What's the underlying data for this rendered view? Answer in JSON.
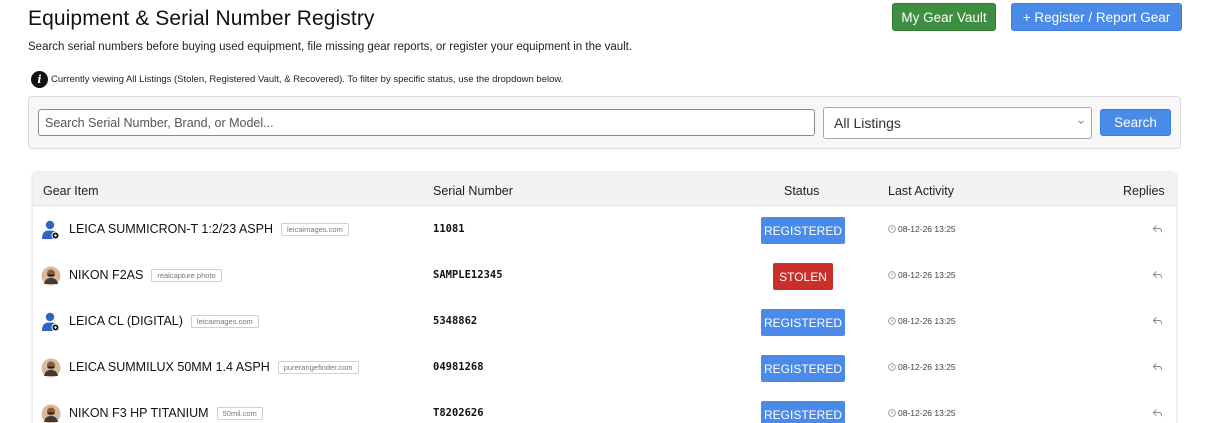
{
  "header": {
    "title": "Equipment & Serial Number Registry",
    "subtitle": "Search serial numbers before buying used equipment, file missing gear reports, or register your equipment in the vault.",
    "vault_button": "My Gear Vault",
    "register_button": "+ Register / Report Gear"
  },
  "info": {
    "text": "Currently viewing All Listings (Stolen, Registered Vault, & Recovered). To filter by specific status, use the dropdown below."
  },
  "search": {
    "placeholder": "Search Serial Number, Brand, or Model...",
    "value": "",
    "filter_selected": "All Listings",
    "button": "Search"
  },
  "table": {
    "columns": {
      "gear": "Gear Item",
      "serial": "Serial Number",
      "status": "Status",
      "activity": "Last Activity",
      "replies": "Replies"
    },
    "rows": [
      {
        "gear": "LEICA SUMMICRON-T 1:2/23 ASPH",
        "domain": "leicaimages.com",
        "serial": "11081",
        "status": "REGISTERED",
        "activity": "08-12-26 13:25",
        "avatar": "user-blue-icon"
      },
      {
        "gear": "NIKON F2AS",
        "domain": "realcapture.photo",
        "serial": "SAMPLE12345",
        "status": "STOLEN",
        "activity": "08-12-26 13:25",
        "avatar": "user-photo-icon"
      },
      {
        "gear": "LEICA CL (DIGITAL)",
        "domain": "leicaimages.com",
        "serial": "5348862",
        "status": "REGISTERED",
        "activity": "08-12-26 13:25",
        "avatar": "user-blue-icon"
      },
      {
        "gear": "LEICA SUMMILUX 50MM 1.4 ASPH",
        "domain": "purerangefinder.com",
        "serial": "04981268",
        "status": "REGISTERED",
        "activity": "08-12-26 13:25",
        "avatar": "user-photo-icon"
      },
      {
        "gear": "NIKON F3 HP TITANIUM",
        "domain": "50mil.com",
        "serial": "T8202626",
        "status": "REGISTERED",
        "activity": "08-12-26 13:25",
        "avatar": "user-photo-icon"
      }
    ]
  },
  "colors": {
    "primary": "#4a8ae8",
    "vault_green": "#3e8e41",
    "stolen_red": "#c9302c"
  }
}
